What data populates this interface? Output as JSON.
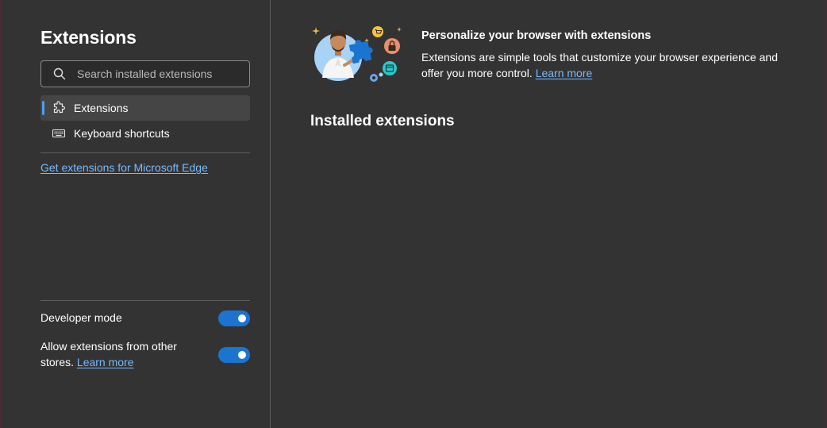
{
  "sidebar": {
    "title": "Extensions",
    "search": {
      "placeholder": "Search installed extensions",
      "value": ""
    },
    "nav": [
      {
        "label": "Extensions",
        "icon": "puzzle-icon",
        "active": true
      },
      {
        "label": "Keyboard shortcuts",
        "icon": "keyboard-icon",
        "active": false
      }
    ],
    "get_extensions_link": "Get extensions for Microsoft Edge",
    "developer_mode": {
      "label": "Developer mode",
      "enabled": true
    },
    "other_stores": {
      "label": "Allow extensions from other stores.",
      "link": "Learn more",
      "enabled": true
    }
  },
  "main": {
    "banner": {
      "title": "Personalize your browser with extensions",
      "text": "Extensions are simple tools that customize your browser experience and offer you more control.",
      "link": "Learn more",
      "illustration": "person-with-puzzle-illustration"
    },
    "installed_title": "Installed extensions"
  },
  "colors": {
    "background": "#333333",
    "accent": "#1a74d0",
    "link": "#78b9ff",
    "active_indicator": "#4aa0f0"
  }
}
